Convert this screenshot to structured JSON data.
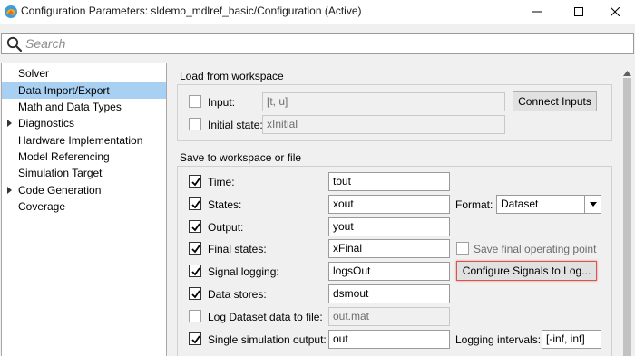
{
  "window": {
    "title": "Configuration Parameters: sldemo_mdlref_basic/Configuration (Active)"
  },
  "search": {
    "placeholder": "Search"
  },
  "tree": {
    "items": [
      {
        "label": "Solver",
        "expandable": false,
        "selected": false
      },
      {
        "label": "Data Import/Export",
        "expandable": false,
        "selected": true
      },
      {
        "label": "Math and Data Types",
        "expandable": false,
        "selected": false
      },
      {
        "label": "Diagnostics",
        "expandable": true,
        "selected": false
      },
      {
        "label": "Hardware Implementation",
        "expandable": false,
        "selected": false
      },
      {
        "label": "Model Referencing",
        "expandable": false,
        "selected": false
      },
      {
        "label": "Simulation Target",
        "expandable": false,
        "selected": false
      },
      {
        "label": "Code Generation",
        "expandable": true,
        "selected": false
      },
      {
        "label": "Coverage",
        "expandable": false,
        "selected": false
      }
    ]
  },
  "load": {
    "title": "Load from workspace",
    "input_label": "Input:",
    "input_value": "[t, u]",
    "input_checked": false,
    "connect_button": "Connect Inputs",
    "initial_label": "Initial state:",
    "initial_value": "xInitial",
    "initial_checked": false
  },
  "save": {
    "title": "Save to workspace or file",
    "time_label": "Time:",
    "time_value": "tout",
    "time_checked": true,
    "states_label": "States:",
    "states_value": "xout",
    "states_checked": true,
    "format_label": "Format:",
    "format_value": "Dataset",
    "output_label": "Output:",
    "output_value": "yout",
    "output_checked": true,
    "final_label": "Final states:",
    "final_value": "xFinal",
    "final_checked": true,
    "operating_point_label": "Save final operating point",
    "operating_point_checked": false,
    "logging_label": "Signal logging:",
    "logging_value": "logsOut",
    "logging_checked": true,
    "configure_button": "Configure Signals to Log...",
    "stores_label": "Data stores:",
    "stores_value": "dsmout",
    "stores_checked": true,
    "dataset_file_label": "Log Dataset data to file:",
    "dataset_file_value": "out.mat",
    "dataset_file_checked": false,
    "single_label": "Single simulation output:",
    "single_value": "out",
    "single_checked": true,
    "intervals_label": "Logging intervals:",
    "intervals_value": "[-inf, inf]"
  }
}
